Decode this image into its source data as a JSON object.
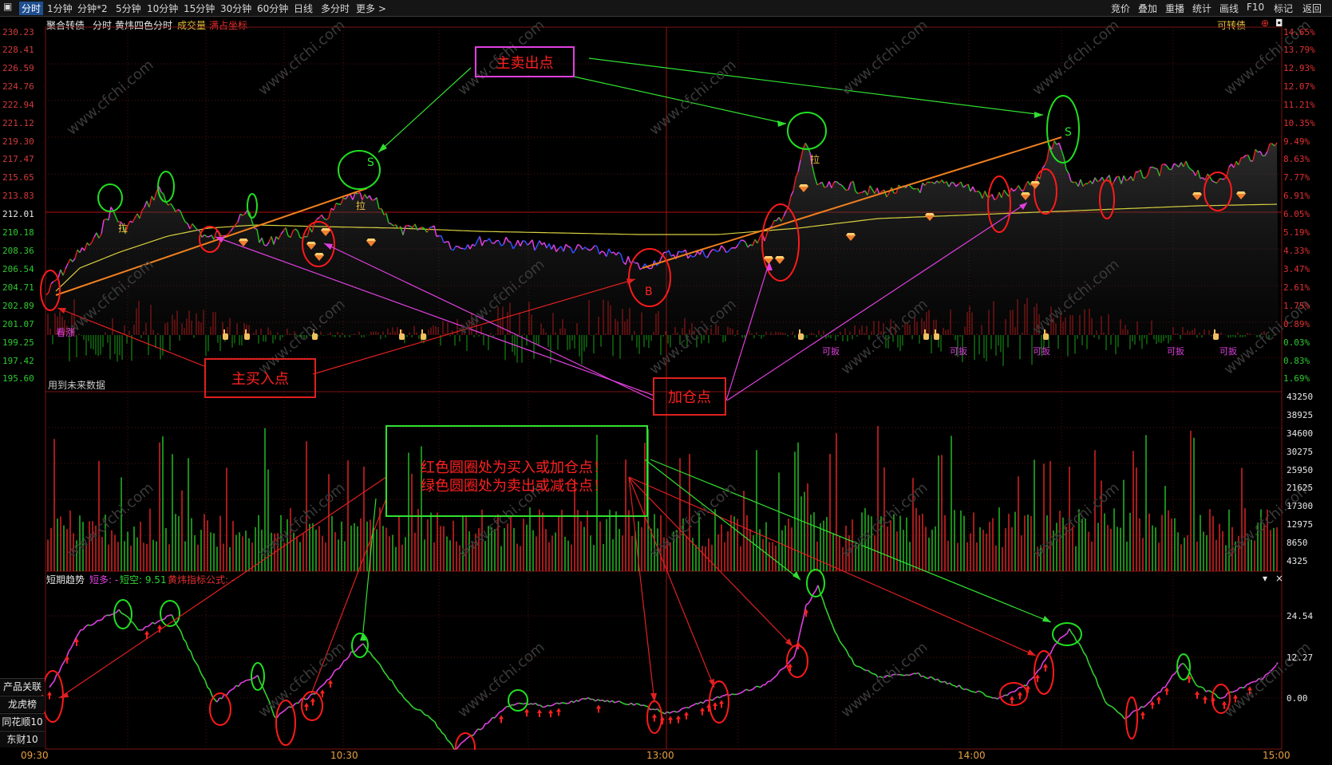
{
  "toolbar": {
    "tabs": [
      "分时",
      "1分钟",
      "分钟*2",
      "5分钟",
      "10分钟",
      "15分钟",
      "30分钟",
      "60分钟",
      "日线",
      "多分时",
      "更多 >"
    ],
    "right": [
      "竞价",
      "叠加",
      "重播",
      "统计",
      "画线",
      "F10",
      "标记",
      "返回"
    ]
  },
  "header": {
    "name": "聚合转债",
    "mode": "分时",
    "indicator": "黄炜四色分时",
    "volume": "成交量",
    "coord": "满占坐标",
    "right_label": "可转债"
  },
  "price_axis": [
    "230.23",
    "228.41",
    "226.59",
    "224.76",
    "222.94",
    "221.12",
    "219.30",
    "217.47",
    "215.65",
    "213.83",
    "212.01",
    "210.18",
    "208.36",
    "206.54",
    "204.71",
    "202.89",
    "201.07",
    "199.25",
    "197.42",
    "195.60"
  ],
  "pct_axis": [
    "14.65%",
    "13.79%",
    "12.93%",
    "12.07%",
    "11.21%",
    "10.35%",
    "9.49%",
    "8.63%",
    "7.77%",
    "6.91%",
    "6.05%",
    "5.19%",
    "4.33%",
    "3.47%",
    "2.61%",
    "1.75%",
    "0.89%",
    "0.03%",
    "0.83%",
    "1.69%"
  ],
  "volume_axis": [
    "43250",
    "38925",
    "34600",
    "30275",
    "25950",
    "21625",
    "17300",
    "12975",
    "8650",
    "4325"
  ],
  "indicator_axis": [
    "24.54",
    "12.27",
    "0.00"
  ],
  "time_axis": [
    "09:30",
    "10:30",
    "13:00",
    "14:00",
    "15:00"
  ],
  "sidebar": [
    "产品关联",
    "龙虎榜",
    "同花顺10",
    "东财10"
  ],
  "future_note": "用到未来数据",
  "sub_header": {
    "name": "短期趋势",
    "long_label": "短多: -",
    "short_label": "短空: 9.51",
    "formula": "黄炜指标公式: -"
  },
  "annotations": {
    "sell_point": "主卖出点",
    "buy_point": "主买入点",
    "add_point": "加仓点",
    "note_line1": "红色圆圈处为买入或加仓点！",
    "note_line2": "绿色圆圈处为卖出或减仓点！",
    "b_marker": "B",
    "s_marker": "S",
    "s_marker2": "S",
    "pull1": "拉",
    "pull2": "拉",
    "pull3": "拉",
    "look_up": "看涨",
    "rebound": [
      "可扳",
      "可扳",
      "可扳",
      "可扳",
      "可扳"
    ]
  },
  "colors": {
    "up": "#e02020",
    "down": "#20c020",
    "avg": "#d8d040",
    "trend": "#f08020",
    "magenta": "#e040e0",
    "blue": "#3050ff",
    "bg": "#000000"
  },
  "watermark": "www.cfchi.com"
}
